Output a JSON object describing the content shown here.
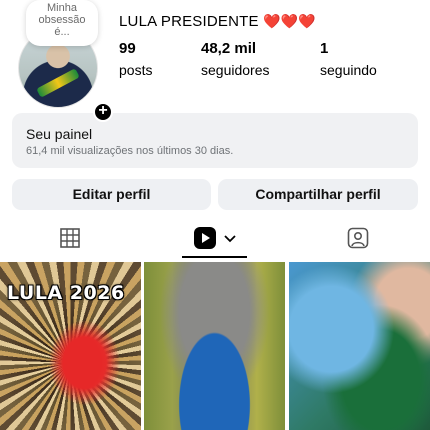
{
  "profile": {
    "note": "Minha obsessão é...",
    "name": "LULA PRESIDENTE",
    "name_emoji": "❤️❤️❤️"
  },
  "stats": [
    {
      "value": "99",
      "label": "posts"
    },
    {
      "value": "48,2 mil",
      "label": "seguidores"
    },
    {
      "value": "1",
      "label": "seguindo"
    }
  ],
  "dashboard": {
    "title": "Seu painel",
    "subtitle": "61,4 mil visualizações nos últimos 30 dias."
  },
  "buttons": {
    "edit": "Editar perfil",
    "share": "Compartilhar perfil"
  },
  "tabs": {
    "grid_icon": "grid-icon",
    "reels_icon": "reels-icon",
    "tagged_icon": "tagged-icon",
    "active": "reels"
  },
  "posts": [
    {
      "overlay_text": "LULA 2026"
    },
    {
      "overlay_text": ""
    },
    {
      "overlay_text": ""
    }
  ],
  "colors": {
    "heart": "#e0242c",
    "panel_bg": "#f0f1f3",
    "button_bg": "#eef0f3"
  }
}
